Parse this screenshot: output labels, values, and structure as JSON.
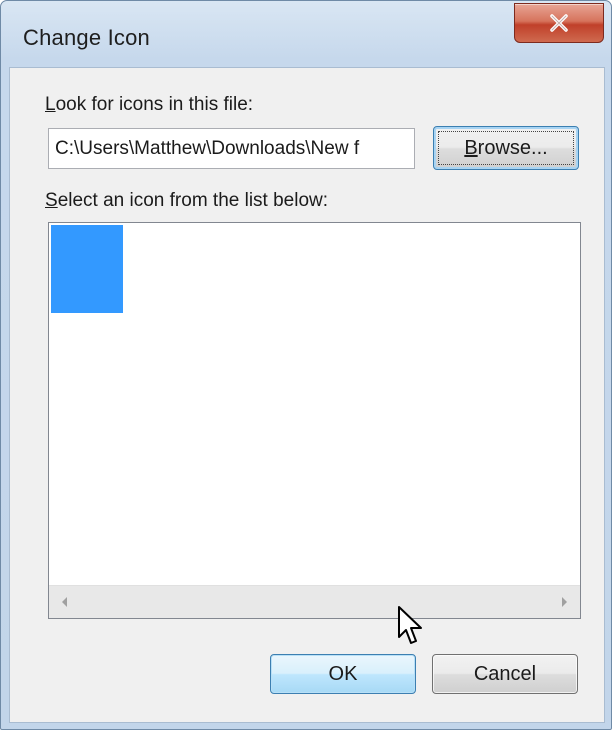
{
  "window": {
    "title": "Change Icon",
    "close_symbol": "✕"
  },
  "file_section": {
    "label_accel": "L",
    "label_rest": "ook for icons in this file:",
    "path_value": "C:\\Users\\Matthew\\Downloads\\New f",
    "browse_accel": "B",
    "browse_rest": "rowse..."
  },
  "list_section": {
    "label_accel": "S",
    "label_rest": "elect an icon from the list below:",
    "selected_item_color": "#3399ff"
  },
  "buttons": {
    "ok_label": "OK",
    "cancel_label": "Cancel"
  },
  "icons": {
    "close": "close-icon",
    "scroll_left": "scroll-left-arrow-icon",
    "scroll_right": "scroll-right-arrow-icon",
    "cursor": "mouse-pointer-icon"
  }
}
